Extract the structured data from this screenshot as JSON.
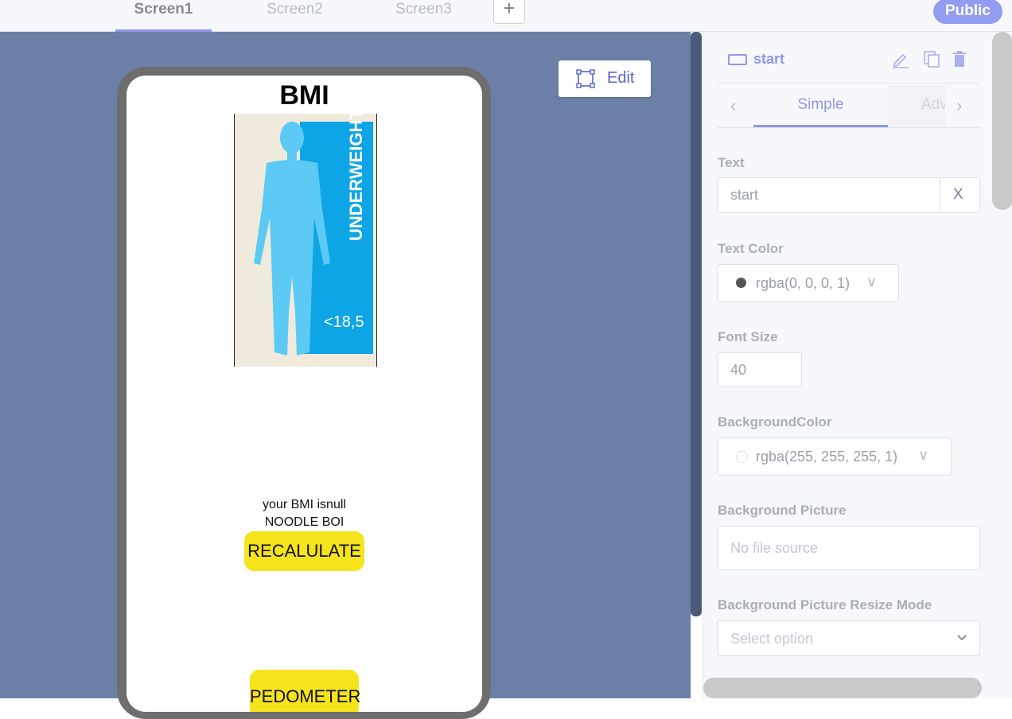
{
  "tabs": [
    {
      "label": "Screen1",
      "active": true
    },
    {
      "label": "Screen2",
      "active": false
    },
    {
      "label": "Screen3",
      "active": false
    }
  ],
  "add_tab_label": "+",
  "public_label": "Public",
  "edit_label": "Edit",
  "screen": {
    "title": "BMI",
    "image": {
      "category": "UNDERWEIGHT",
      "range": "<18,5"
    },
    "result_line1": "your BMI isnull",
    "result_line2": "NOODLE BOI",
    "recalculate_label": "RECALULATE",
    "pedometer_label": "PEDOMETER"
  },
  "panel": {
    "component_name": "start",
    "tabs": {
      "simple": "Simple",
      "advanced": "Adv"
    },
    "text": {
      "label": "Text",
      "value": "start",
      "clear": "X"
    },
    "text_color": {
      "label": "Text Color",
      "value": "rgba(0, 0, 0, 1)",
      "swatch": "#555555"
    },
    "font_size": {
      "label": "Font Size",
      "value": "40"
    },
    "background_color": {
      "label": "BackgroundColor",
      "value": "rgba(255, 255, 255, 1)",
      "swatch": "#ffffff"
    },
    "background_picture": {
      "label": "Background Picture",
      "placeholder": "No file source"
    },
    "resize_mode": {
      "label": "Background Picture Resize Mode",
      "placeholder": "Select option"
    }
  },
  "colors": {
    "accent": "#8f97ec",
    "canvas": "#6c7fa7",
    "button_yellow": "#f5e31c"
  }
}
